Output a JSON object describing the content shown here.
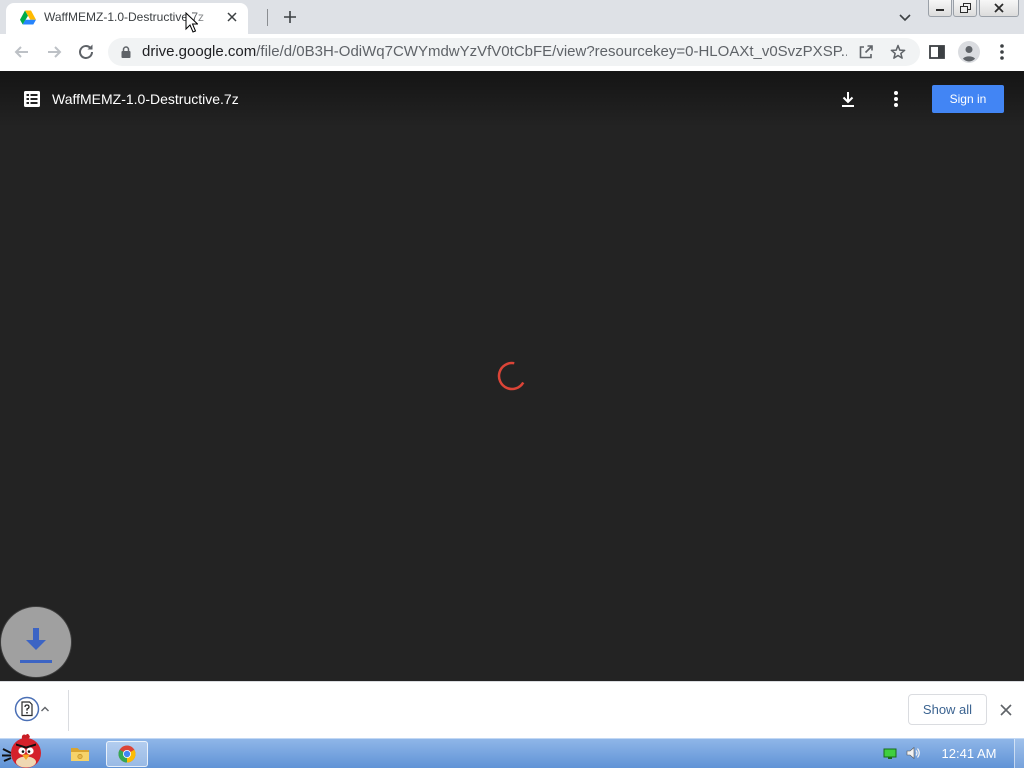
{
  "tab_strip": {
    "tab": {
      "title": "WaffMEMZ-1.0-Destructive.7z",
      "favicon": "google-drive-icon",
      "close_icon": "close-icon"
    },
    "new_tab_icon": "plus-icon",
    "tab_search_icon": "chevron-down-icon",
    "window_controls": [
      "minimize-icon",
      "restore-icon",
      "close-icon"
    ]
  },
  "toolbar": {
    "back_icon": "arrow-left-icon",
    "forward_icon": "arrow-right-icon",
    "reload_icon": "reload-icon",
    "omnibox": {
      "security_icon": "lock-icon",
      "url_host": "drive.google.com",
      "url_rest": "/file/d/0B3H-OdiWq7CWYmdwYzVfV0tCbFE/view?resourcekey=0-HLOAXt_v0SvzPXSP...",
      "share_icon": "share-icon",
      "bookmark_icon": "star-outline-icon"
    },
    "side_panel_icon": "side-panel-icon",
    "profile_icon": "person-avatar-icon",
    "menu_icon": "more-vert-icon"
  },
  "viewer": {
    "header": {
      "file_type_icon": "file-list-icon",
      "file_name": "WaffMEMZ-1.0-Destructive.7z",
      "download_icon": "download-icon",
      "more_icon": "more-vert-icon",
      "sign_in_label": "Sign in"
    },
    "spinner_icon": "loading-spinner-icon",
    "floating_download_icon": "download-icon"
  },
  "download_shelf": {
    "item_icon": "unknown-file-icon",
    "item_menu_icon": "chevron-up-icon",
    "show_all_label": "Show all",
    "close_icon": "close-icon"
  },
  "taskbar": {
    "start_icon": "angry-bird-icon",
    "app_icons": [
      "folder-icon",
      "chrome-icon"
    ],
    "active_app_icon": "chrome-icon",
    "tray_icons": [
      "network-icon",
      "volume-icon"
    ],
    "clock": "12:41 AM"
  },
  "colors": {
    "tab_strip": "#dee1e6",
    "viewer_background": "#232323",
    "sign_in_button": "#4285f4",
    "spinner": "#db4437",
    "floating_download_arrow": "#3c64c4",
    "taskbar": "#6f9fdc"
  }
}
